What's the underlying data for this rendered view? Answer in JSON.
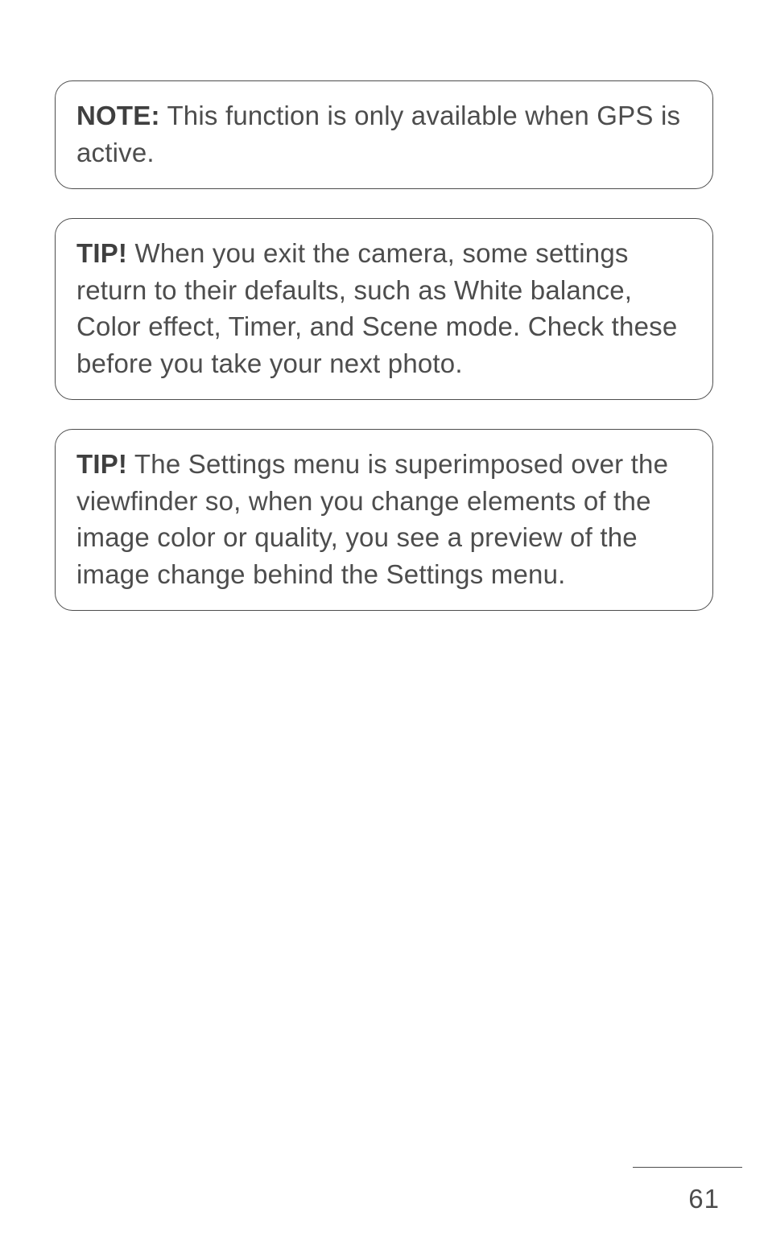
{
  "callouts": [
    {
      "label": "NOTE:",
      "text": " This function is only available when GPS is active."
    },
    {
      "label": "TIP!",
      "text": " When you exit the camera, some settings return to their defaults, such as White balance, Color effect, Timer, and Scene mode. Check these before you take your next photo."
    },
    {
      "label": "TIP!",
      "text": " The Settings menu is superimposed over the viewfinder so, when you change elements of the image color or quality, you see a preview of the image change behind the Settings menu."
    }
  ],
  "page_number": "61"
}
